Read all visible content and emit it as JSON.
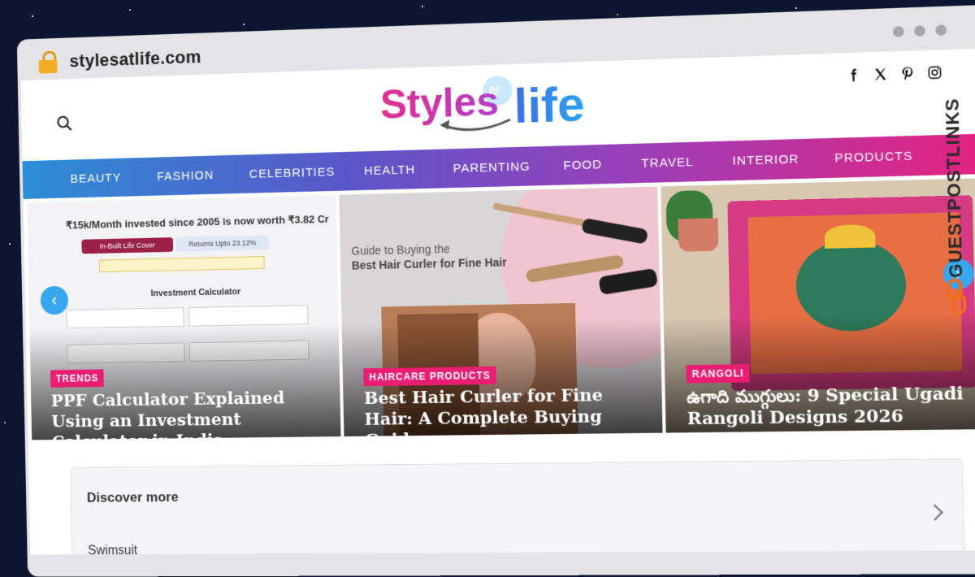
{
  "browser": {
    "url": "stylesatlife.com"
  },
  "site": {
    "logo_text_styles": "Styles",
    "logo_text_at": "at",
    "logo_text_life": "life",
    "social_icons": [
      "facebook-icon",
      "x-icon",
      "pinterest-icon",
      "instagram-icon"
    ]
  },
  "nav": {
    "items": [
      "BEAUTY",
      "FASHION",
      "CELEBRITIES",
      "HEALTH",
      "PARENTING",
      "FOOD",
      "TRAVEL",
      "INTERIOR",
      "PRODUCTS"
    ]
  },
  "slides": [
    {
      "tag": "TRENDS",
      "title": "PPF Calculator Explained Using an Investment Calculator in India",
      "image_heading": "₹15k/Month invested since 2005 is now worth ₹3.82 Cr",
      "image_tab1": "In-Built Life Cover",
      "image_tab2": "Returns Upto 23.12%",
      "image_section": "Investment Calculator"
    },
    {
      "tag": "HAIRCARE PRODUCTS",
      "title": "Best Hair Curler for Fine Hair: A Complete Buying Guide",
      "image_heading_line1": "Guide to Buying the",
      "image_heading_line2": "Best Hair Curler for Fine Hair"
    },
    {
      "tag": "RANGOLI",
      "title": "ఉగాది ముగ్గులు: 9 Special Ugadi Rangoli Designs 2026"
    }
  ],
  "discover": {
    "heading": "Discover more",
    "first_item": "Swimsuit"
  },
  "watermark": "GUESTPOSTLINKS",
  "colors": {
    "nav_start": "#2b8ed6",
    "nav_end": "#e4237f",
    "tag": "#e91e73",
    "arrow": "#37a7f0"
  }
}
